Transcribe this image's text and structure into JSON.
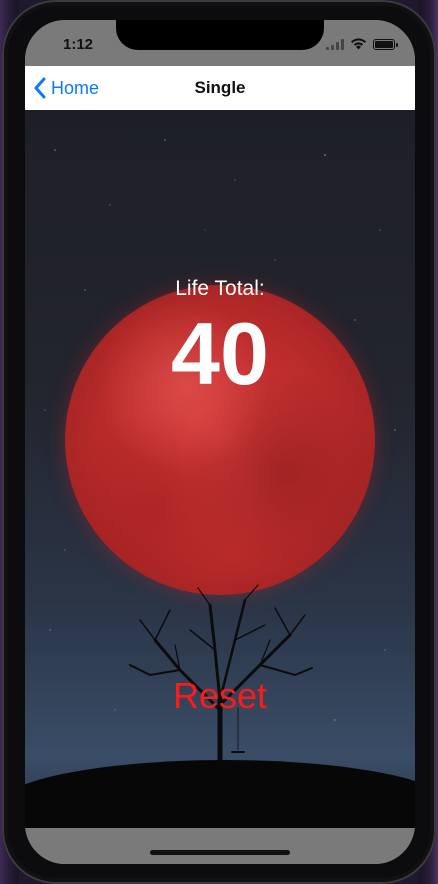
{
  "status_bar": {
    "time": "1:12"
  },
  "nav": {
    "back_label": "Home",
    "title": "Single"
  },
  "life": {
    "label": "Life Total:",
    "value": "40"
  },
  "actions": {
    "reset_label": "Reset"
  },
  "colors": {
    "accent_blue": "#0a7aff",
    "reset_red": "#ff1a1a",
    "moon_red": "#c32f2f"
  },
  "icons": {
    "back": "chevron-left-icon",
    "wifi": "wifi-icon",
    "battery": "battery-icon",
    "signal": "cellular-signal-icon"
  }
}
